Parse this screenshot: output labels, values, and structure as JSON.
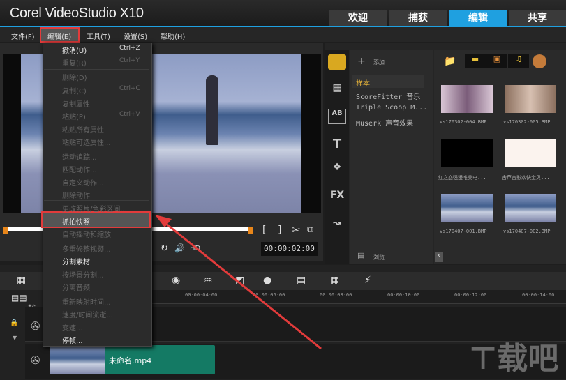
{
  "app": {
    "title": "Corel VideoStudio X10"
  },
  "tabs": [
    {
      "label": "欢迎"
    },
    {
      "label": "捕获"
    },
    {
      "label": "编辑"
    },
    {
      "label": "共享"
    }
  ],
  "menubar": [
    "文件(F)",
    "编辑(E)",
    "工具(T)",
    "设置(S)",
    "帮助(H)"
  ],
  "edit_menu": {
    "items": [
      {
        "label": "撤消(U)",
        "shortcut": "Ctrl+Z",
        "enabled": true
      },
      {
        "label": "重复(R)",
        "shortcut": "Ctrl+Y",
        "enabled": false
      },
      {
        "label": "删除(D)",
        "shortcut": "",
        "enabled": false
      },
      {
        "label": "复制(C)",
        "shortcut": "Ctrl+C",
        "enabled": false
      },
      {
        "label": "复制属性",
        "shortcut": "",
        "enabled": false
      },
      {
        "label": "粘贴(P)",
        "shortcut": "Ctrl+V",
        "enabled": false
      },
      {
        "label": "粘贴所有属性",
        "shortcut": "",
        "enabled": false
      },
      {
        "label": "粘贴可选属性...",
        "shortcut": "",
        "enabled": false
      },
      {
        "label": "运动追踪...",
        "shortcut": "",
        "enabled": false
      },
      {
        "label": "匹配动作...",
        "shortcut": "",
        "enabled": false
      },
      {
        "label": "自定义动作...",
        "shortcut": "",
        "enabled": false
      },
      {
        "label": "删除动作",
        "shortcut": "",
        "enabled": false
      },
      {
        "label": "更改照片/色彩区间...",
        "shortcut": "",
        "enabled": false
      },
      {
        "label": "抓拍快照",
        "shortcut": "",
        "enabled": true
      },
      {
        "label": "自动摇动和缩放",
        "shortcut": "",
        "enabled": false
      },
      {
        "label": "多重修整视频...",
        "shortcut": "",
        "enabled": false
      },
      {
        "label": "分割素材",
        "shortcut": "",
        "enabled": true
      },
      {
        "label": "按场景分割...",
        "shortcut": "",
        "enabled": false
      },
      {
        "label": "分离音频",
        "shortcut": "",
        "enabled": false
      },
      {
        "label": "重新映射时间...",
        "shortcut": "",
        "enabled": false
      },
      {
        "label": "速度/时间流逝...",
        "shortcut": "",
        "enabled": false
      },
      {
        "label": "变速...",
        "shortcut": "",
        "enabled": false
      },
      {
        "label": "停帧...",
        "shortcut": "",
        "enabled": true
      }
    ]
  },
  "player": {
    "timecode": "00:00:02:00",
    "mark_in": "[",
    "mark_out": "]",
    "hd": "HD"
  },
  "library": {
    "add_label": "添加",
    "browse_label": "浏览",
    "folders": [
      "样本",
      "ScoreFitter 音乐",
      "Triple Scoop M...",
      "Muserk 声音效果"
    ],
    "thumbs": [
      "vs170302-004.BMP",
      "vs170302-005.BMP",
      "红之恋强漫唯美电...",
      "舍芦舍影欢快宝贝...",
      "vs170407-001.BMP",
      "vs170407-002.BMP"
    ]
  },
  "timeline": {
    "ticks": [
      "00:00:04:00",
      "00:00:06:00",
      "00:00:08:00",
      "00:00:10:00",
      "00:00:12:00",
      "00:00:14:00"
    ],
    "zoom_label": "+/-",
    "clip_name": "未命名.mp4"
  },
  "watermark": {
    "text": "下载吧",
    "url": "www.xiazaiba.com"
  },
  "colors": {
    "accent": "#1fa0e0",
    "highlight": "#e23b3b",
    "clip": "#147a64"
  }
}
